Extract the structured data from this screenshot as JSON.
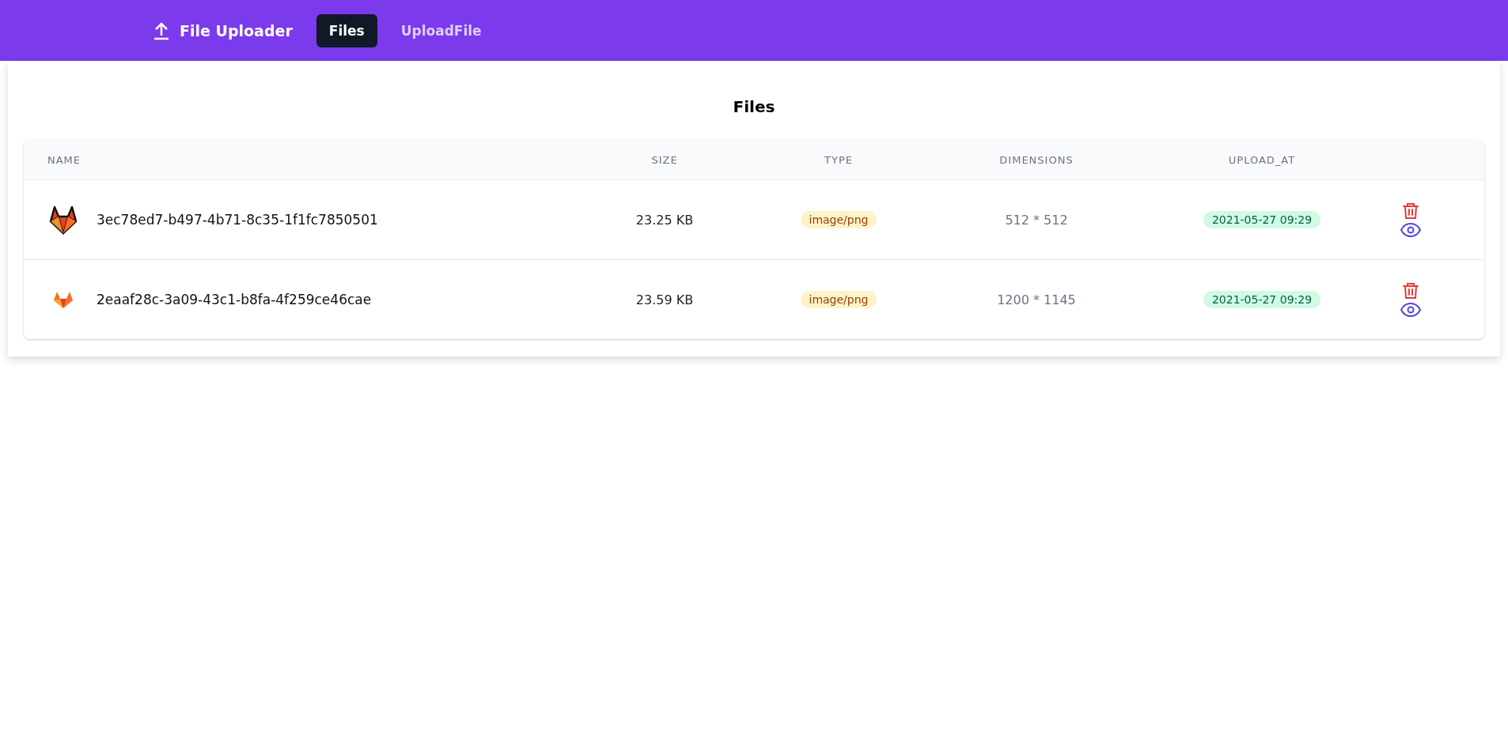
{
  "navbar": {
    "brand": "File Uploader",
    "tabs": [
      {
        "label": "Files",
        "selected": true
      },
      {
        "label": "UploadFile",
        "selected": false
      }
    ]
  },
  "page": {
    "title": "Files"
  },
  "table": {
    "columns": [
      "NAME",
      "SIZE",
      "TYPE",
      "DIMENSIONS",
      "UPLOAD_AT"
    ],
    "rows": [
      {
        "name": "3ec78ed7-b497-4b71-8c35-1f1fc7850501",
        "size": "23.25 KB",
        "type": "image/png",
        "dimensions": "512 * 512",
        "upload_at": "2021-05-27 09:29",
        "kind": "outlined"
      },
      {
        "name": "2eaaf28c-3a09-43c1-b8fa-4f259ce46cae",
        "size": "23.59 KB",
        "type": "image/png",
        "dimensions": "1200 * 1145",
        "upload_at": "2021-05-27 09:29",
        "kind": "flat"
      }
    ]
  }
}
